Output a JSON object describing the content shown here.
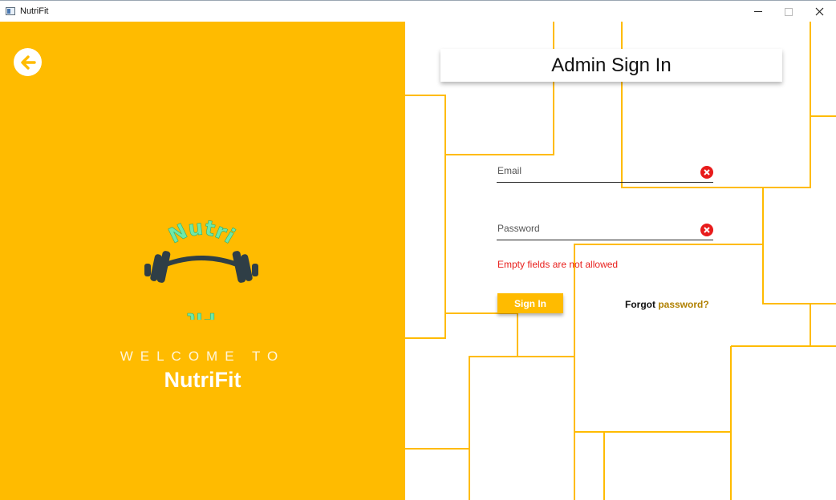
{
  "window": {
    "title": "NutriFit",
    "controls": [
      "minimize",
      "maximize",
      "close"
    ]
  },
  "colors": {
    "accent": "#ffbb00",
    "error": "#e8201d",
    "clear_icon": "#e81b1b"
  },
  "left_panel": {
    "back_icon": "arrow-left-circle-icon",
    "logo": {
      "top_text": "Nutri",
      "bottom_text": "Fit",
      "icon": "barbell-icon"
    },
    "welcome": "WELCOME TO",
    "brand": "NutriFit"
  },
  "form": {
    "title": "Admin Sign In",
    "email": {
      "placeholder": "Email",
      "value": ""
    },
    "password": {
      "placeholder": "Password",
      "value": ""
    },
    "clear_icon": "clear-x-icon",
    "error": "Empty fields are not allowed",
    "signin_label": "Sign In",
    "forgot_part1": "Forgot",
    "forgot_part2": " password?"
  }
}
